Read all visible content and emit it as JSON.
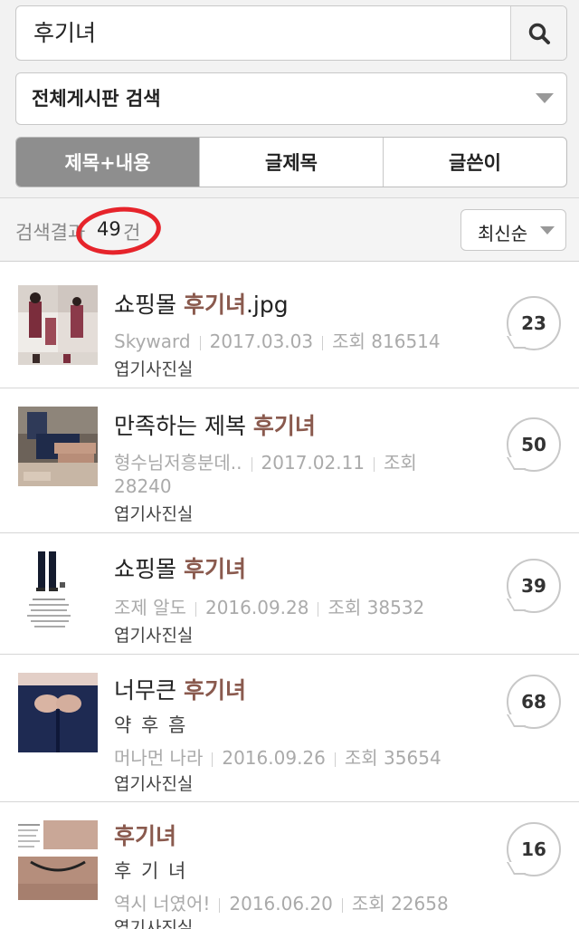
{
  "search": {
    "query": "후기녀"
  },
  "scope_select": {
    "value": "전체게시판 검색"
  },
  "tabs": [
    {
      "label": "제목+내용",
      "active": true
    },
    {
      "label": "글제목",
      "active": false
    },
    {
      "label": "글쓴이",
      "active": false
    }
  ],
  "results": {
    "label": "검색결과",
    "count": "49",
    "unit": "건"
  },
  "sort": {
    "value": "최신순"
  },
  "highlight_color": "#8a5a4e",
  "posts": [
    {
      "title_prefix": "쇼핑몰 ",
      "title_highlight": "후기녀",
      "title_suffix": ".jpg",
      "subtitle": "",
      "author": "Skyward",
      "date": "2017.03.03",
      "views_label": "조회",
      "views": "816514",
      "board": "엽기사진실",
      "comments": "23"
    },
    {
      "title_prefix": "만족하는 제복 ",
      "title_highlight": "후기녀",
      "title_suffix": "",
      "subtitle": "",
      "author": "형수님저흥분데..",
      "date": "2017.02.11",
      "views_label": "조회",
      "views": "28240",
      "board": "엽기사진실",
      "comments": "50"
    },
    {
      "title_prefix": "쇼핑몰 ",
      "title_highlight": "후기녀",
      "title_suffix": "",
      "subtitle": "",
      "author": "조제 알도",
      "date": "2016.09.28",
      "views_label": "조회",
      "views": "38532",
      "board": "엽기사진실",
      "comments": "39"
    },
    {
      "title_prefix": "너무큰 ",
      "title_highlight": "후기녀",
      "title_suffix": "",
      "subtitle": "약 후 흠",
      "author": "머나먼 나라",
      "date": "2016.09.26",
      "views_label": "조회",
      "views": "35654",
      "board": "엽기사진실",
      "comments": "68"
    },
    {
      "title_prefix": "",
      "title_highlight": "후기녀",
      "title_suffix": "",
      "subtitle": "후 기 녀",
      "author": "역시 너였어!",
      "date": "2016.06.20",
      "views_label": "조회",
      "views": "22658",
      "board": "엽기사진실",
      "comments": "16"
    }
  ]
}
